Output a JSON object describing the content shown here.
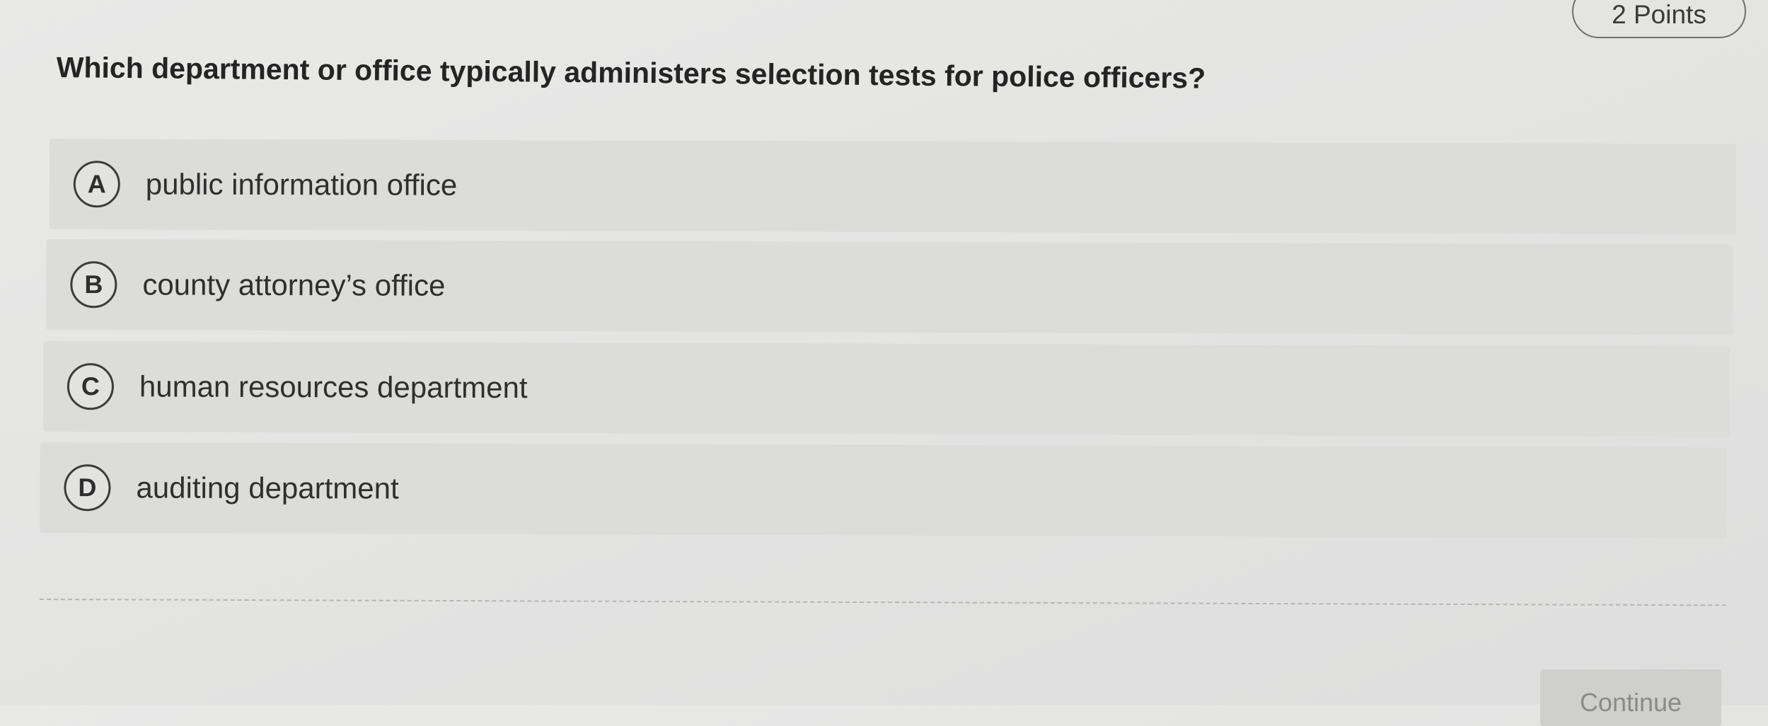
{
  "header": {
    "points_label": "2 Points"
  },
  "question": {
    "text": "Which department or office typically administers selection tests for police officers?"
  },
  "options": [
    {
      "letter": "A",
      "label": "public information office"
    },
    {
      "letter": "B",
      "label": "county attorney’s office"
    },
    {
      "letter": "C",
      "label": "human resources department"
    },
    {
      "letter": "D",
      "label": "auditing department"
    }
  ],
  "footer": {
    "continue_label": "Continue"
  }
}
